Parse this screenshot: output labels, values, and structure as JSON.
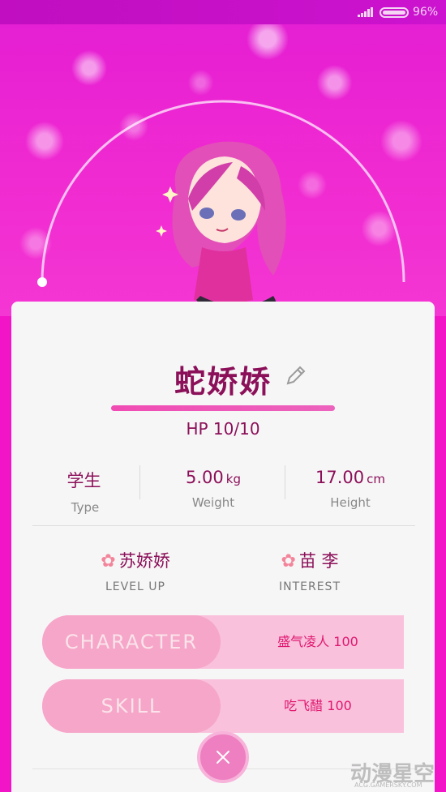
{
  "status_bar": {
    "battery_percent": "96%",
    "battery_level": 0.96
  },
  "character": {
    "name": "蛇娇娇",
    "hp": "HP 10/10",
    "hp_fraction": 1.0
  },
  "stats": [
    {
      "value": "学生",
      "unit": "",
      "label": "Type"
    },
    {
      "value": "5.00",
      "unit": "kg",
      "label": "Weight"
    },
    {
      "value": "17.00",
      "unit": "cm",
      "label": "Height"
    }
  ],
  "relations": [
    {
      "name": "苏娇娇",
      "label": "LEVEL UP"
    },
    {
      "name": "苗 李",
      "label": "INTEREST"
    }
  ],
  "attributes": [
    {
      "tag": "CHARACTER",
      "value": "盛气凌人 100"
    },
    {
      "tag": "SKILL",
      "value": "吃飞醋 100"
    }
  ],
  "watermark": {
    "text": "动漫星空",
    "sub": "ACG.GAMERSKY.COM"
  },
  "colors": {
    "accent": "#8b1059",
    "pink": "#f214c7",
    "pill": "#f6a6c9"
  }
}
